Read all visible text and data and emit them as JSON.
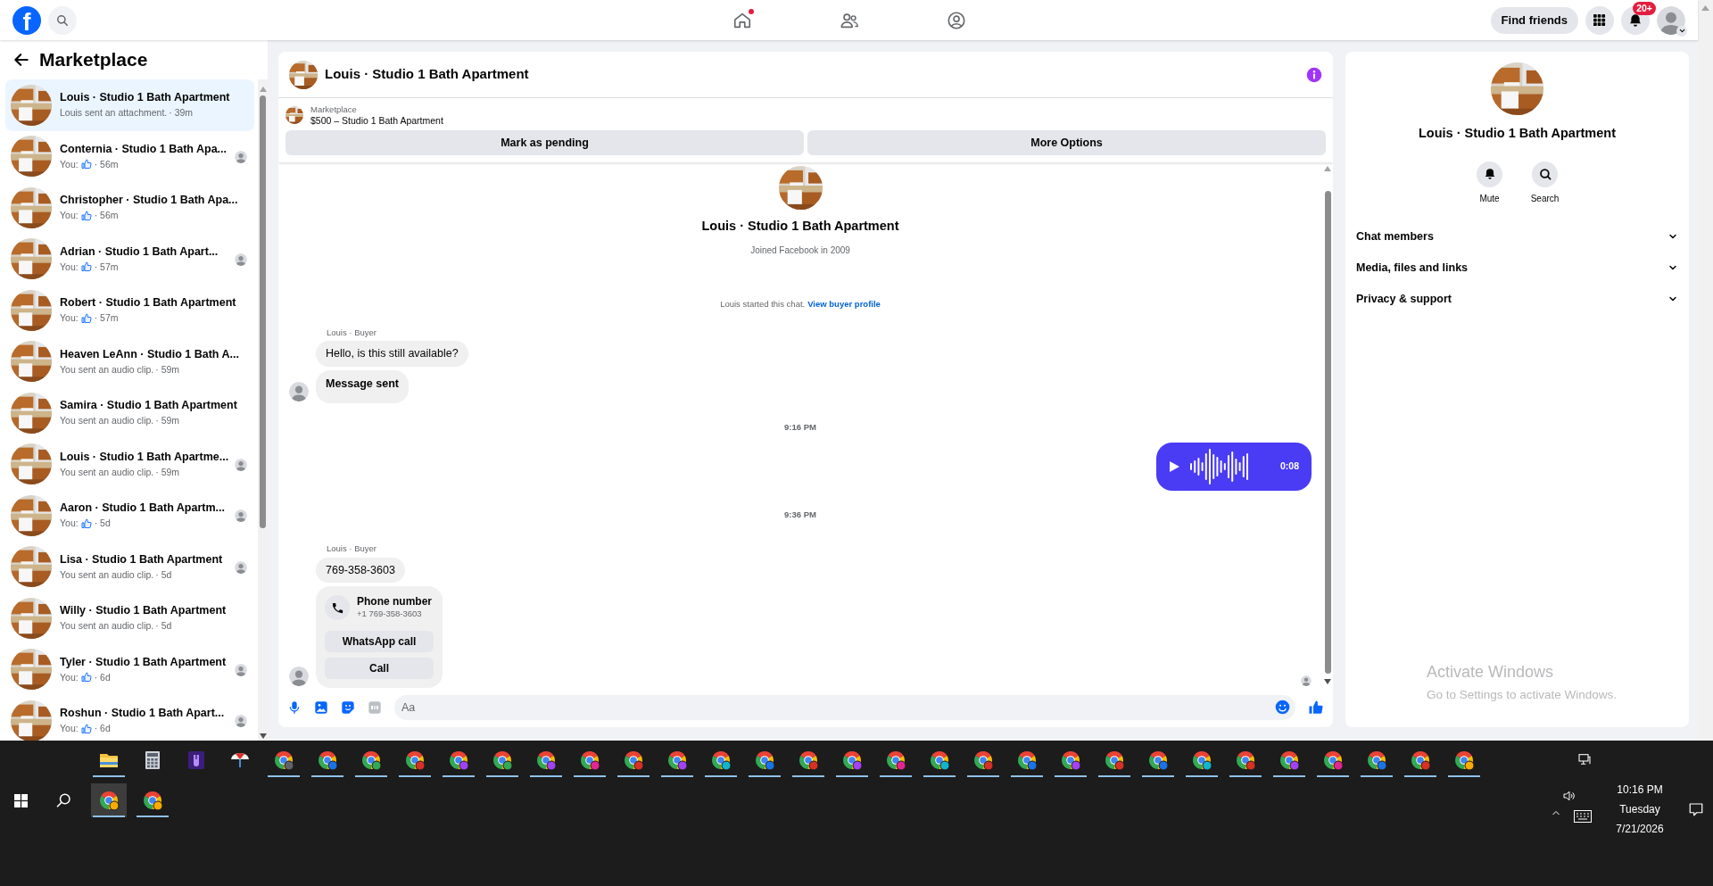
{
  "topbar": {
    "logo": "f",
    "nav": [
      {
        "kind": "home",
        "dot": true
      },
      {
        "kind": "friends",
        "dot": false
      },
      {
        "kind": "profile",
        "dot": false
      }
    ],
    "find_friends": "Find friends",
    "notifications_badge": "20+"
  },
  "sidebar": {
    "title": "Marketplace",
    "conversations": [
      {
        "name": "Louis · Studio 1 Bath Apartment",
        "kind": "text",
        "preview": "Louis sent an attachment.",
        "time": "· 39m",
        "selected": true,
        "seen": false
      },
      {
        "name": "Conternia · Studio 1 Bath Apa...",
        "kind": "like",
        "preview": "You:",
        "time": "· 56m",
        "selected": false,
        "seen": true
      },
      {
        "name": "Christopher · Studio 1 Bath Apa...",
        "kind": "like",
        "preview": "You:",
        "time": "· 56m",
        "selected": false,
        "seen": false
      },
      {
        "name": "Adrian · Studio 1 Bath Apart...",
        "kind": "like",
        "preview": "You:",
        "time": "· 57m",
        "selected": false,
        "seen": true
      },
      {
        "name": "Robert · Studio 1 Bath Apartment",
        "kind": "like",
        "preview": "You:",
        "time": "· 57m",
        "selected": false,
        "seen": false
      },
      {
        "name": "Heaven LeAnn · Studio 1 Bath A...",
        "kind": "text",
        "preview": "You sent an audio clip.",
        "time": "· 59m",
        "selected": false,
        "seen": false
      },
      {
        "name": "Samira · Studio 1 Bath Apartment",
        "kind": "text",
        "preview": "You sent an audio clip.",
        "time": "· 59m",
        "selected": false,
        "seen": false
      },
      {
        "name": "Louis · Studio 1 Bath Apartme...",
        "kind": "text",
        "preview": "You sent an audio clip.",
        "time": "· 59m",
        "selected": false,
        "seen": true
      },
      {
        "name": "Aaron · Studio 1 Bath Apartm...",
        "kind": "like",
        "preview": "You:",
        "time": "· 5d",
        "selected": false,
        "seen": true
      },
      {
        "name": "Lisa · Studio 1 Bath Apartment",
        "kind": "text",
        "preview": "You sent an audio clip.",
        "time": "· 5d",
        "selected": false,
        "seen": true
      },
      {
        "name": "Willy · Studio 1 Bath Apartment",
        "kind": "text",
        "preview": "You sent an audio clip.",
        "time": "· 5d",
        "selected": false,
        "seen": false
      },
      {
        "name": "Tyler · Studio 1 Bath Apartment",
        "kind": "like",
        "preview": "You:",
        "time": "· 6d",
        "selected": false,
        "seen": true
      },
      {
        "name": "Roshun · Studio 1 Bath Apart...",
        "kind": "like",
        "preview": "You:",
        "time": "· 6d",
        "selected": false,
        "seen": true
      }
    ]
  },
  "chat": {
    "title": "Louis · Studio 1 Bath Apartment",
    "listing": {
      "label": "Marketplace",
      "title": "$500 – Studio 1 Bath Apartment"
    },
    "actions": [
      "Mark as pending",
      "More Options"
    ],
    "profile": {
      "name": "Louis · Studio 1 Bath Apartment",
      "joined": "Joined Facebook in 2009"
    },
    "started": {
      "text": "Louis started this chat.",
      "link": "View buyer profile"
    },
    "items": [
      {
        "kind": "group",
        "sender": "Louis · Buyer",
        "messages": [
          {
            "kind": "text",
            "text": "Hello, is this still available?"
          },
          {
            "kind": "status",
            "text": "Message sent"
          }
        ]
      },
      {
        "kind": "time",
        "text": "9:16 PM"
      },
      {
        "kind": "audio",
        "duration": "0:08"
      },
      {
        "kind": "time",
        "text": "9:36 PM"
      },
      {
        "kind": "group",
        "sender": "Louis · Buyer",
        "messages": [
          {
            "kind": "text",
            "text": "769-358-3603"
          },
          {
            "kind": "phone",
            "title": "Phone number",
            "number": "+1 769-358-3603",
            "buttons": [
              "WhatsApp call",
              "Call"
            ]
          }
        ]
      }
    ],
    "seen": true,
    "composer": {
      "placeholder": "Aa"
    }
  },
  "details": {
    "name": "Louis · Studio 1 Bath Apartment",
    "actions": [
      {
        "kind": "mute",
        "label": "Mute"
      },
      {
        "kind": "search",
        "label": "Search"
      }
    ],
    "sections": [
      {
        "label": "Chat members",
        "expanded": false
      },
      {
        "label": "Media, files and links",
        "expanded": false
      },
      {
        "label": "Privacy & support",
        "expanded": false
      }
    ]
  },
  "activation_notice": {
    "title": "Activate Windows",
    "text": "Go to Settings to activate Windows."
  },
  "taskbar": {
    "row1": [
      {
        "kind": "folder",
        "running": true
      },
      {
        "kind": "calculator",
        "running": false
      },
      {
        "kind": "app",
        "running": false
      },
      {
        "kind": "umbrella",
        "running": false
      },
      {
        "kind": "browser",
        "color": "#5f6368",
        "running": true
      },
      {
        "kind": "browser",
        "color": "#1a73e8",
        "running": true
      },
      {
        "kind": "browser",
        "color": "#34a853",
        "running": true
      },
      {
        "kind": "browser",
        "color": "#d93025",
        "running": true
      },
      {
        "kind": "browser",
        "color": "#a142f4",
        "running": true
      },
      {
        "kind": "browser",
        "color": "#34a853",
        "running": true
      },
      {
        "kind": "browser",
        "color": "#a142f4",
        "running": true
      },
      {
        "kind": "browser",
        "color": "#e52592",
        "running": true
      },
      {
        "kind": "browser",
        "color": "#d93025",
        "running": true
      },
      {
        "kind": "browser",
        "color": "#a142f4",
        "running": true
      },
      {
        "kind": "browser",
        "color": "#12b5cb",
        "running": true
      },
      {
        "kind": "browser",
        "color": "#1a73e8",
        "running": true
      },
      {
        "kind": "browser",
        "color": "#d93025",
        "running": true
      },
      {
        "kind": "browser",
        "color": "#a142f4",
        "running": true
      },
      {
        "kind": "browser",
        "color": "#e52592",
        "running": true
      },
      {
        "kind": "browser",
        "color": "#12b5cb",
        "running": true
      },
      {
        "kind": "browser",
        "color": "#d93025",
        "running": true
      },
      {
        "kind": "browser",
        "color": "#1a73e8",
        "running": true
      },
      {
        "kind": "browser",
        "color": "#a142f4",
        "running": true
      },
      {
        "kind": "browser",
        "color": "#d93025",
        "running": true
      },
      {
        "kind": "browser",
        "color": "#1a73e8",
        "running": true
      },
      {
        "kind": "browser",
        "color": "#12b5cb",
        "running": true
      },
      {
        "kind": "browser",
        "color": "#d93025",
        "running": true
      },
      {
        "kind": "browser",
        "color": "#a142f4",
        "running": true
      },
      {
        "kind": "browser",
        "color": "#e52592",
        "running": true
      },
      {
        "kind": "browser",
        "color": "#1a73e8",
        "running": true
      },
      {
        "kind": "browser",
        "color": "#d93025",
        "running": true
      },
      {
        "kind": "browser",
        "color": "#f9ab00",
        "running": true
      }
    ],
    "row2": [
      {
        "kind": "browser",
        "color": "#f9ab00",
        "running": true,
        "selected": true
      },
      {
        "kind": "browser",
        "color": "#f9ab00",
        "running": true,
        "selected": false
      }
    ],
    "tray": {
      "time": "10:16 PM",
      "day": "Tuesday",
      "date": "7/21/2026"
    }
  }
}
